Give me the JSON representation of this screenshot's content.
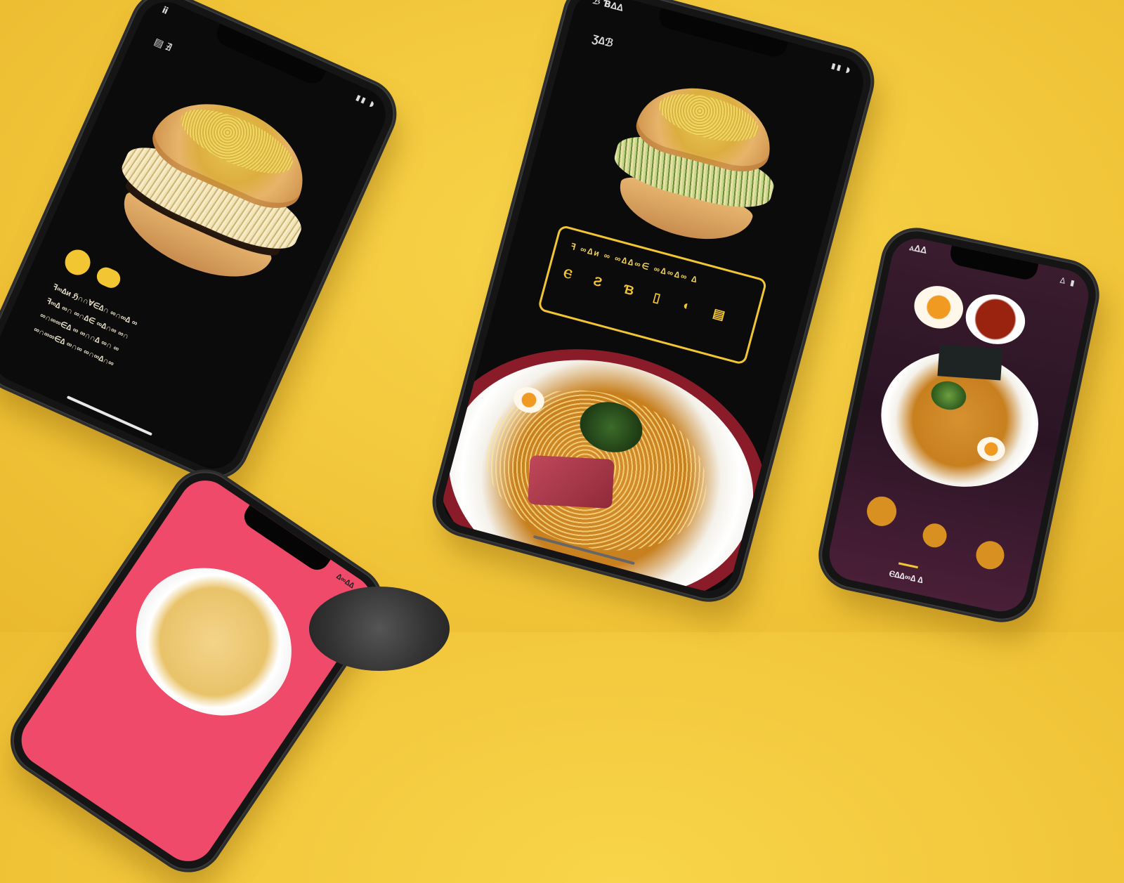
{
  "scene": {
    "background_color": "#f2c63a",
    "accent_color": "#f2c632"
  },
  "phone_left": {
    "status_time": "ⅱ",
    "status_icons": "▮▮ ◗",
    "menu_label": "▤ ∄",
    "screen_color": "#0b0b0b",
    "hero_image": "ramen-burger",
    "icons": [
      "coin-icon",
      "bowl-icon"
    ],
    "description_lines": [
      "ꟻ∞∆ᴎ ℌ∩∩∀∈∆∩ ∞∩∞∆ ∞",
      "ꟻ∞∆ ∞∩ ∞∩∆∈ ∞∆∩∞ ∞∩",
      "∞∩∞∞∈∆ ∞ ∞∩∩∆ ∞∩ ∞",
      "∞∩∞∞∈∆ ∞∩∞ ∞∩∞∆∩∞"
    ]
  },
  "phone_center": {
    "status_time": "ℬ Ɓ∆∆",
    "menu_label": "Ʒ∆ℬ",
    "status_icons": "▮▮ ◗",
    "screen_color": "#0b0b0b",
    "hero_image": "ramen-burger",
    "info_box": {
      "title": "ꟻ ∞∆ᴎ ∞ ∞∆∆∞∈ ∞∆∞∆∞ ∆",
      "glyphs": [
        "Ⲉ",
        "Ƨ",
        "Ɓ",
        "▯",
        "◐",
        "▤"
      ]
    },
    "bottom_image": "ramen-bowl"
  },
  "phone_right": {
    "status_time": "ⲁ∆∆",
    "status_icons": "∆ ▮",
    "screen_color": "#3a1c2e",
    "hero_image": "ramen-bowl-with-sides",
    "footer_text": "▬▬▬",
    "footer_caption": "Ⲉ∆∆∞∆ ∆"
  },
  "phone_bottom": {
    "status_text": "∆∞∆∆",
    "screen_color": "#ef4a6a",
    "image": "ramen-bowl"
  }
}
